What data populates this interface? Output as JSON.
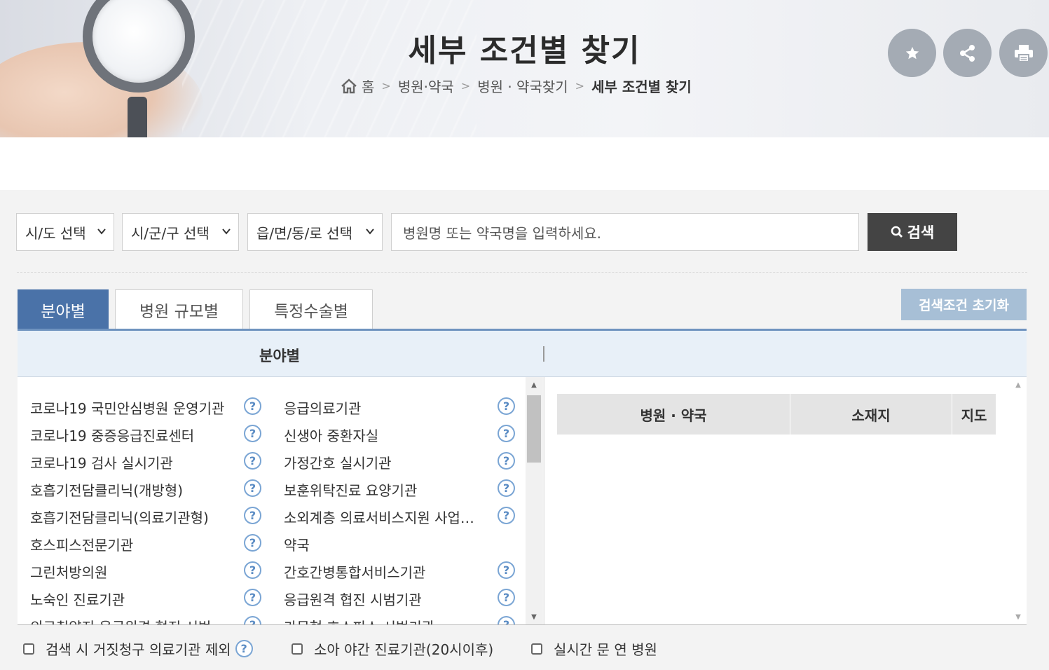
{
  "header": {
    "title": "세부 조건별 찾기",
    "breadcrumb": [
      "홈",
      "병원·약국",
      "병원 · 약국찾기",
      "세부 조건별 찾기"
    ]
  },
  "actions": {
    "favorite_icon": "star-icon",
    "share_icon": "share-icon",
    "print_icon": "print-icon"
  },
  "search": {
    "sido_label": "시/도 선택",
    "sigungu_label": "시/군/구 선택",
    "emd_label": "읍/면/동/로 선택",
    "placeholder": "병원명 또는 약국명을 입력하세요.",
    "button": "검색"
  },
  "tabs": [
    "분야별",
    "병원 규모별",
    "특정수술별"
  ],
  "reset_button": "검색조건 초기화",
  "panel_header": "분야별",
  "categories_left": [
    "코로나19 국민안심병원 운영기관",
    "코로나19 중증응급진료센터",
    "코로나19 검사 실시기관",
    "호흡기전담클리닉(개방형)",
    "호흡기전담클리닉(의료기관형)",
    "호스피스전문기관",
    "그린처방의원",
    "노숙인 진료기관",
    "의료취약지 응급원격 협진 시범"
  ],
  "categories_right": [
    "응급의료기관",
    "신생아 중환자실",
    "가정간호 실시기관",
    "보훈위탁진료 요양기관",
    "소외계층 의료서비스지원 사업…",
    "약국",
    "간호간병통합서비스기관",
    "응급원격 협진 시범기관",
    "가문형 호스피스 시범기관"
  ],
  "help_glyph": "?",
  "results_table": {
    "columns": [
      "병원 · 약국",
      "소재지",
      "지도"
    ]
  },
  "filters": [
    "검색 시 거짓청구 의료기관 제외",
    "소아 야간 진료기관(20시이후)",
    "실시간 문 연 병원"
  ],
  "colors": {
    "tab_active": "#4a72a8",
    "search_button": "#444444",
    "reset_button": "#a7bfd6",
    "help_icon": "#5b8cc4"
  }
}
